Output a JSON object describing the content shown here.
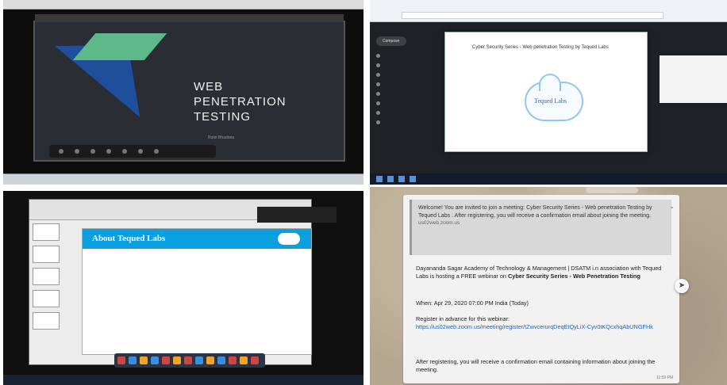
{
  "q1": {
    "slide_title": "WEB\nPENETRATION\nTESTING",
    "presenter": "Rohit Bhadoria"
  },
  "q2": {
    "email_subject": "Cyber Security Series - Web penetration Testing by Tequed Labs",
    "logo_name": "Tequed Labs",
    "compose_label": "Compose"
  },
  "q3": {
    "slide_header": "About Tequed Labs"
  },
  "q4": {
    "quoted": "Welcome! You are invited to join a meeting: Cyber Security Series - Web penetration Testing by Tequed Labs . After registering, you will receive a confirmation email about joining the meeting.",
    "quoted_domain": "us02web.zoom.us",
    "intro": "Dayananda Sagar Academy of Technology & Management | DSATM i.n association with Tequed Labs is hosting a FREE webinar on",
    "intro_bold": "Cyber Security Series - Web Penetration Testing",
    "when": "When: Apr 29, 2020 07:00 PM India (Today)",
    "register_label": "Register in advance for this webinar:",
    "register_link": "https://us02web.zoom.us/meeting/register/tZwvcerurqDeqEtQyLiX-Cyv0tKQcxhqAbUNGFHk",
    "after": "After registering, you will receive a confirmation email containing information about joining the meeting.",
    "time": "11:59 PM"
  }
}
